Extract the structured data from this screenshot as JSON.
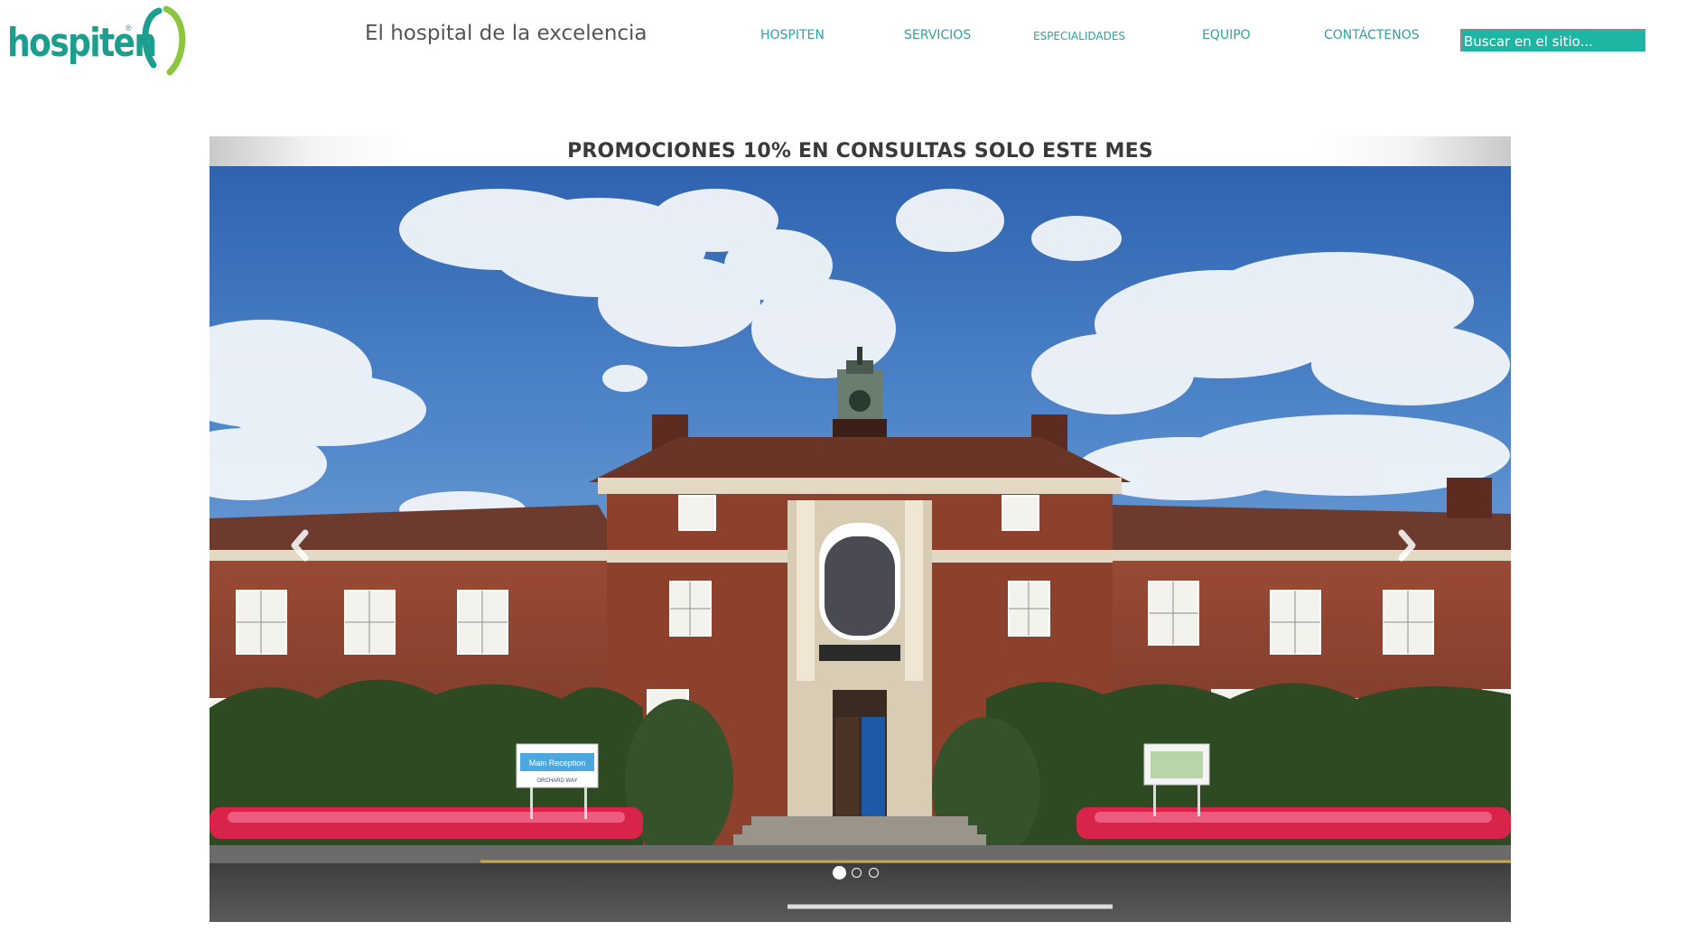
{
  "brand": {
    "name": "hospiten",
    "registered_mark": "®",
    "tagline": "El hospital de la excelencia",
    "accent_color": "#1c9e8e",
    "logo_ring_green": "#8cc63f"
  },
  "nav": {
    "items": [
      {
        "label": "HOSPITEN"
      },
      {
        "label": "SERVICIOS"
      },
      {
        "label": "ESPECIALIDADES"
      },
      {
        "label": "EQUIPO"
      },
      {
        "label": "CONTÁCTENOS"
      }
    ],
    "color": "#2aa5a0"
  },
  "search": {
    "placeholder": "Buscar en el sitio...",
    "icon": "none"
  },
  "promo": {
    "title": "PROMOCIONES 10% EN CONSULTAS SOLO ESTE MES"
  },
  "slider": {
    "image_alt": "Edificio del hospital de ladrillo con torre de reloj",
    "sign_text": "Main Reception",
    "sign_subtext": "ORCHARD WAY",
    "prev_icon": "chevron-left-icon",
    "next_icon": "chevron-right-icon",
    "slide_count": 3,
    "active_slide": 1
  }
}
